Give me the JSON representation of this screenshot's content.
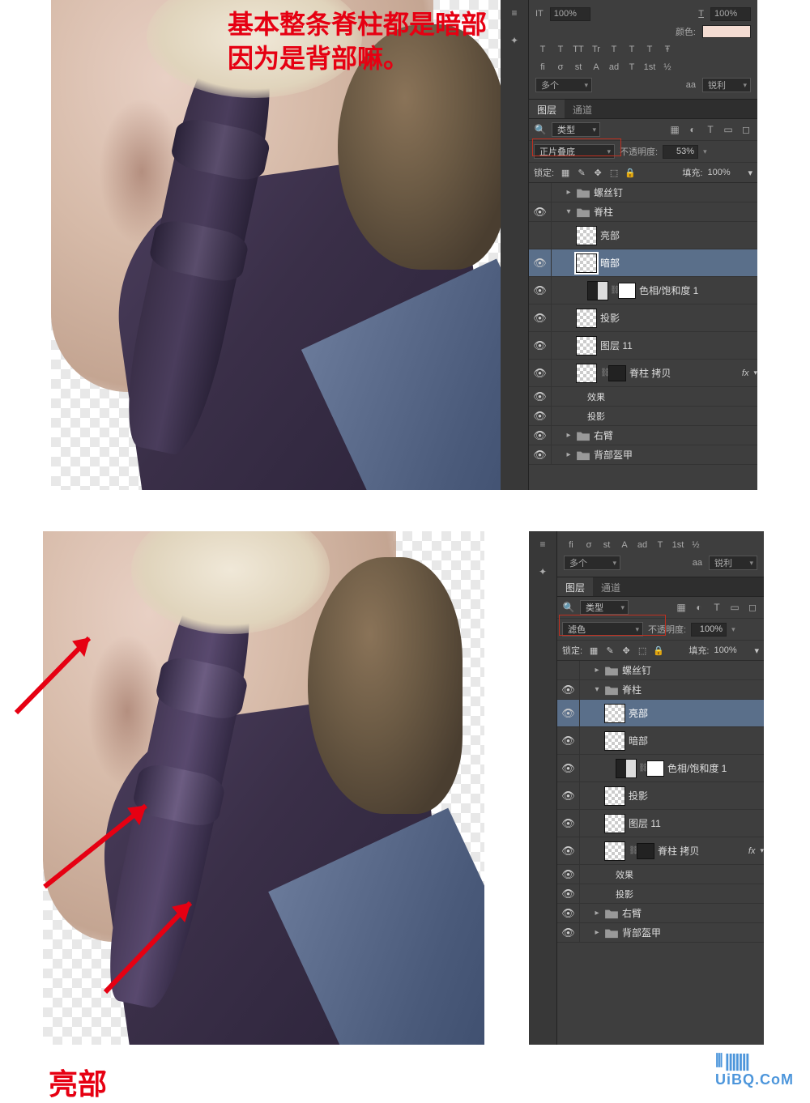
{
  "annotations": {
    "line1": "基本整条脊柱都是暗部",
    "line2": "因为是背部嘛。",
    "bottom": "亮部"
  },
  "watermark": "UiBQ.CoM",
  "panel_top": {
    "char": {
      "it_label": "IT",
      "it_value": "100%",
      "t_label": "T",
      "t_value": "100%",
      "color_label": "颜色:",
      "opentype_row": [
        "T",
        "T",
        "TT",
        "Tr",
        "T",
        "T",
        "T",
        "Ŧ"
      ],
      "fi_row": [
        "fi",
        "σ",
        "st",
        "A",
        "ad",
        "T",
        "1st",
        "½"
      ],
      "lang": "多个",
      "aa_label": "aa",
      "aa_value": "锐利"
    },
    "layers": {
      "tab_layers": "图层",
      "tab_channels": "通道",
      "filter_label": "类型",
      "blend_mode": "正片叠底",
      "opacity_label": "不透明度:",
      "opacity_value": "53%",
      "lock_label": "锁定:",
      "fill_label": "填充:",
      "fill_value": "100%",
      "tree": {
        "group_screws": "螺丝钉",
        "group_spine": "脊柱",
        "layer_highlight": "亮部",
        "layer_dark": "暗部",
        "layer_huesat": "色相/饱和度 1",
        "layer_shadow": "投影",
        "layer_layer11": "图层 11",
        "layer_spine_copy": "脊柱 拷贝",
        "fx_label": "fx",
        "fx_effects": "效果",
        "fx_dropshadow": "投影",
        "group_rightarm": "右臂",
        "group_backarmor": "背部盔甲"
      }
    }
  },
  "panel_bottom": {
    "char": {
      "fi_row": [
        "fi",
        "σ",
        "st",
        "A",
        "ad",
        "T",
        "1st",
        "½"
      ],
      "lang": "多个",
      "aa_label": "aa",
      "aa_value": "锐利"
    },
    "layers": {
      "tab_layers": "图层",
      "tab_channels": "通道",
      "filter_label": "类型",
      "blend_mode": "滤色",
      "opacity_label": "不透明度:",
      "opacity_value": "100%",
      "lock_label": "锁定:",
      "fill_label": "填充:",
      "fill_value": "100%",
      "tree": {
        "group_screws": "螺丝钉",
        "group_spine": "脊柱",
        "layer_highlight": "亮部",
        "layer_dark": "暗部",
        "layer_huesat": "色相/饱和度 1",
        "layer_shadow": "投影",
        "layer_layer11": "图层 11",
        "layer_spine_copy": "脊柱 拷贝",
        "fx_label": "fx",
        "fx_effects": "效果",
        "fx_dropshadow": "投影",
        "group_rightarm": "右臂",
        "group_backarmor": "背部盔甲"
      }
    }
  }
}
